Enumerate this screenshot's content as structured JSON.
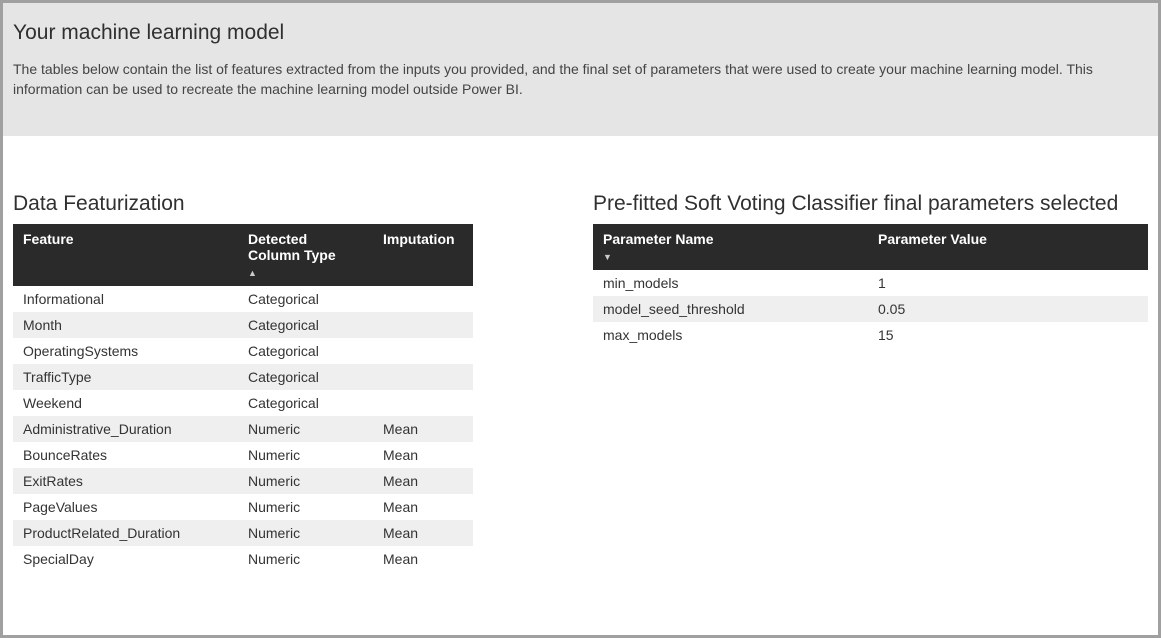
{
  "header": {
    "title": "Your machine learning model",
    "description": "The tables below contain the list of features extracted from the inputs you provided, and the final set of parameters that were used to create your machine learning model.  This information can be used to recreate the machine learning model outside Power BI."
  },
  "featurization": {
    "title": "Data Featurization",
    "columns": {
      "feature": "Feature",
      "detected_type": "Detected Column Type",
      "imputation": "Imputation"
    },
    "rows": [
      {
        "feature": "Informational",
        "detected_type": "Categorical",
        "imputation": ""
      },
      {
        "feature": "Month",
        "detected_type": "Categorical",
        "imputation": ""
      },
      {
        "feature": "OperatingSystems",
        "detected_type": "Categorical",
        "imputation": ""
      },
      {
        "feature": "TrafficType",
        "detected_type": "Categorical",
        "imputation": ""
      },
      {
        "feature": "Weekend",
        "detected_type": "Categorical",
        "imputation": ""
      },
      {
        "feature": "Administrative_Duration",
        "detected_type": "Numeric",
        "imputation": "Mean"
      },
      {
        "feature": "BounceRates",
        "detected_type": "Numeric",
        "imputation": "Mean"
      },
      {
        "feature": "ExitRates",
        "detected_type": "Numeric",
        "imputation": "Mean"
      },
      {
        "feature": "PageValues",
        "detected_type": "Numeric",
        "imputation": "Mean"
      },
      {
        "feature": "ProductRelated_Duration",
        "detected_type": "Numeric",
        "imputation": "Mean"
      },
      {
        "feature": "SpecialDay",
        "detected_type": "Numeric",
        "imputation": "Mean"
      }
    ]
  },
  "parameters": {
    "title": "Pre-fitted Soft Voting Classifier final parameters selected",
    "columns": {
      "name": "Parameter Name",
      "value": "Parameter Value"
    },
    "rows": [
      {
        "name": "min_models",
        "value": "1"
      },
      {
        "name": "model_seed_threshold",
        "value": "0.05"
      },
      {
        "name": "max_models",
        "value": "15"
      }
    ]
  }
}
